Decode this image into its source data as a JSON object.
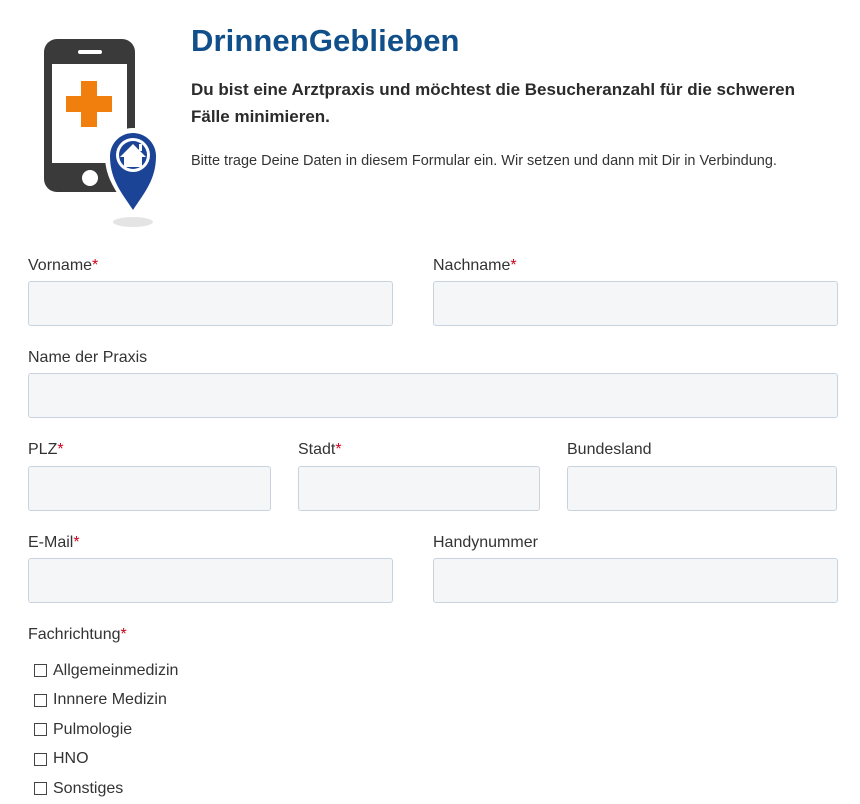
{
  "header": {
    "title": "DrinnenGeblieben",
    "tagline": "Du bist eine Arztpraxis und möchtest die Besucheranzahl für die schweren Fälle minimieren.",
    "intro": "Bitte trage Deine Daten in diesem Formular ein. Wir setzen und dann mit Dir in Verbindung.",
    "logo_icon": "phone-medical-cross-home-pin-icon"
  },
  "form": {
    "required_marker": "*",
    "vorname": {
      "label": "Vorname",
      "value": "",
      "required": true
    },
    "nachname": {
      "label": "Nachname",
      "value": "",
      "required": true
    },
    "praxis": {
      "label": "Name der Praxis",
      "value": "",
      "required": false
    },
    "plz": {
      "label": "PLZ",
      "value": "",
      "required": true
    },
    "stadt": {
      "label": "Stadt",
      "value": "",
      "required": true
    },
    "bundesland": {
      "label": "Bundesland",
      "value": "",
      "required": false
    },
    "email": {
      "label": "E-Mail",
      "value": "",
      "required": true
    },
    "handy": {
      "label": "Handynummer",
      "value": "",
      "required": false
    },
    "fachrichtung": {
      "label": "Fachrichtung",
      "required": true,
      "options": [
        {
          "label": "Allgemeinmedizin",
          "checked": false
        },
        {
          "label": "Innnere Medizin",
          "checked": false
        },
        {
          "label": "Pulmologie",
          "checked": false
        },
        {
          "label": "HNO",
          "checked": false
        },
        {
          "label": "Sonstiges",
          "checked": false
        }
      ]
    }
  },
  "colors": {
    "brand_blue": "#114f8a",
    "pin_blue": "#1b4497",
    "cross_orange": "#f07f0d",
    "phone_dark": "#3a3a3a",
    "required_red": "#d0021b",
    "input_bg": "#f4f6f8",
    "input_border": "#c9d3dd"
  }
}
